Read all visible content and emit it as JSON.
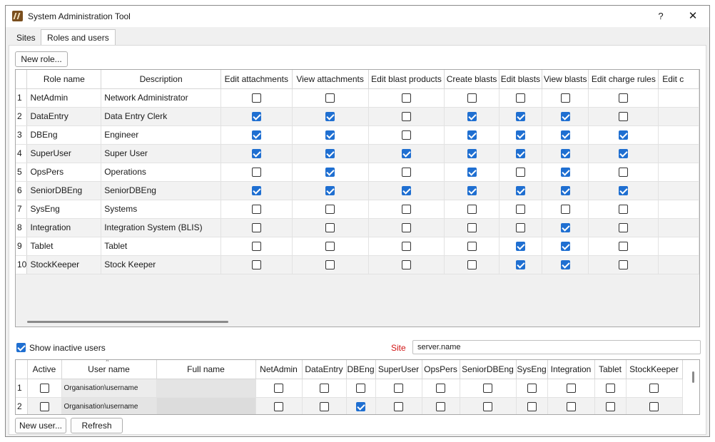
{
  "window": {
    "title": "System Administration Tool",
    "help_label": "?",
    "close_label": "✕"
  },
  "tabs": [
    {
      "label": "Sites",
      "active": false
    },
    {
      "label": "Roles and users",
      "active": true
    }
  ],
  "roles_toolbar": {
    "new_role_label": "New role..."
  },
  "roles_grid": {
    "columns": [
      "Role name",
      "Description",
      "Edit attachments",
      "View attachments",
      "Edit blast products",
      "Create blasts",
      "Edit blasts",
      "View blasts",
      "Edit charge rules",
      "Edit c"
    ],
    "rows": [
      {
        "num": "1",
        "name": "NetAdmin",
        "description": "Network Administrator",
        "perms": [
          false,
          false,
          false,
          false,
          false,
          false,
          false
        ]
      },
      {
        "num": "2",
        "name": "DataEntry",
        "description": "Data Entry Clerk",
        "perms": [
          true,
          true,
          false,
          true,
          true,
          true,
          false
        ]
      },
      {
        "num": "3",
        "name": "DBEng",
        "description": "Engineer",
        "perms": [
          true,
          true,
          false,
          true,
          true,
          true,
          true
        ]
      },
      {
        "num": "4",
        "name": "SuperUser",
        "description": "Super User",
        "perms": [
          true,
          true,
          true,
          true,
          true,
          true,
          true
        ]
      },
      {
        "num": "5",
        "name": "OpsPers",
        "description": "Operations",
        "perms": [
          false,
          true,
          false,
          true,
          false,
          true,
          false
        ]
      },
      {
        "num": "6",
        "name": "SeniorDBEng",
        "description": "SeniorDBEng",
        "perms": [
          true,
          true,
          true,
          true,
          true,
          true,
          true
        ]
      },
      {
        "num": "7",
        "name": "SysEng",
        "description": "Systems",
        "perms": [
          false,
          false,
          false,
          false,
          false,
          false,
          false
        ]
      },
      {
        "num": "8",
        "name": "Integration",
        "description": "Integration System (BLIS)",
        "perms": [
          false,
          false,
          false,
          false,
          false,
          true,
          false
        ]
      },
      {
        "num": "9",
        "name": "Tablet",
        "description": "Tablet",
        "perms": [
          false,
          false,
          false,
          false,
          true,
          true,
          false
        ]
      },
      {
        "num": "10",
        "name": "StockKeeper",
        "description": "Stock Keeper",
        "perms": [
          false,
          false,
          false,
          false,
          true,
          true,
          false
        ]
      }
    ]
  },
  "users_filter": {
    "show_inactive_label": "Show inactive users",
    "show_inactive_checked": true,
    "site_label": "Site",
    "site_value": "server.name"
  },
  "users_grid": {
    "columns": [
      "Active",
      "User name",
      "Full name",
      "NetAdmin",
      "DataEntry",
      "DBEng",
      "SuperUser",
      "OpsPers",
      "SeniorDBEng",
      "SysEng",
      "Integration",
      "Tablet",
      "StockKeeper"
    ],
    "rows": [
      {
        "num": "1",
        "active": false,
        "username": "Organisation\\username",
        "fullname": "",
        "roles": [
          false,
          false,
          false,
          false,
          false,
          false,
          false,
          false,
          false,
          false
        ]
      },
      {
        "num": "2",
        "active": false,
        "username": "Organisation\\username",
        "fullname": "",
        "roles": [
          false,
          false,
          true,
          false,
          false,
          false,
          false,
          false,
          false,
          false
        ]
      }
    ]
  },
  "footer": {
    "new_user_label": "New user...",
    "refresh_label": "Refresh"
  },
  "colors": {
    "checkbox_checked": "#1f6fd1",
    "site_label": "#d11515"
  }
}
